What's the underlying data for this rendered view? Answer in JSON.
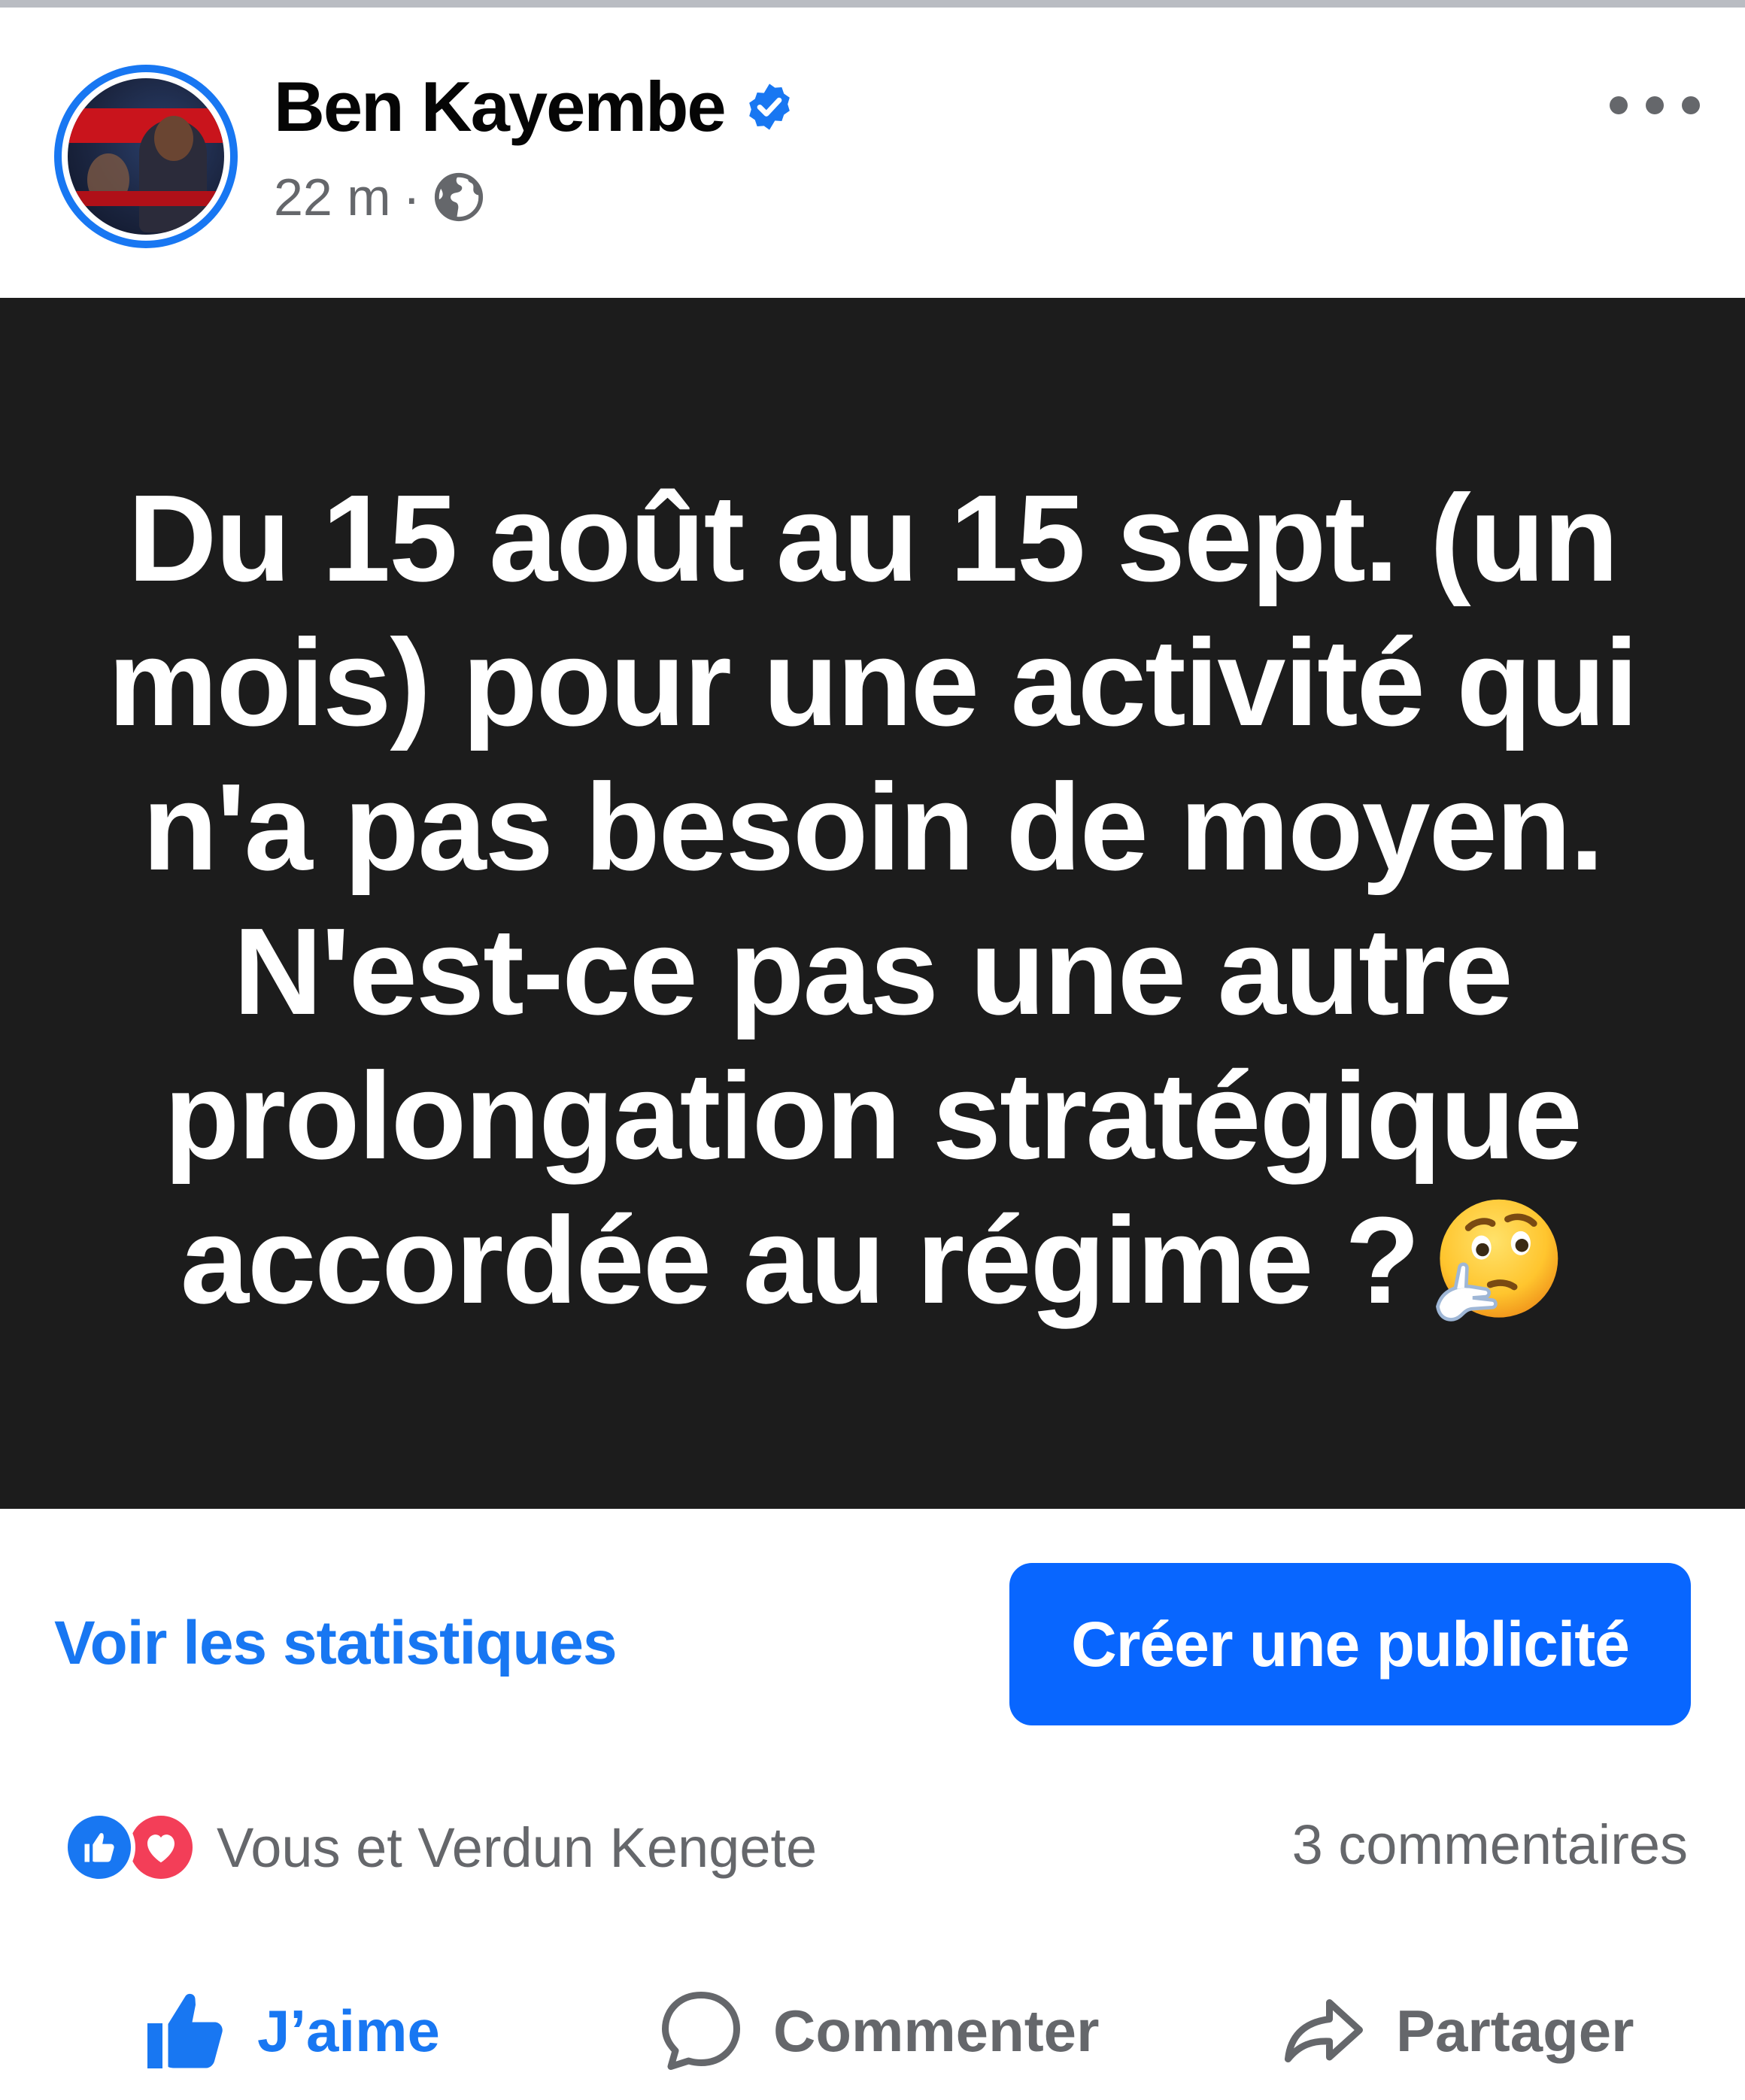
{
  "post": {
    "author": "Ben Kayembe",
    "time": "22 m",
    "separator": "·",
    "visibility_icon": "globe-icon",
    "verified_icon": "verified-badge-icon",
    "more_icon": "more-options-icon",
    "text_lines": [
      "Du 15 août au 15 sept. (un",
      "mois) pour une activité qui",
      "n'a pas besoin de moyen.",
      "N'est-ce pas une autre",
      "prolongation stratégique",
      "accordée au régime ?"
    ],
    "emoji": "thinking-face-emoji"
  },
  "insights": {
    "stats_link": "Voir les statistiques",
    "ad_button": "Créer une publicité"
  },
  "engagement": {
    "reaction_icons": [
      "like-reaction-icon",
      "love-reaction-icon"
    ],
    "reactors": "Vous et Verdun Kengete",
    "comments": "3 commentaires"
  },
  "actions": {
    "like": "J’aime",
    "comment": "Commenter",
    "share": "Partager"
  },
  "colors": {
    "brand_blue": "#1877f2",
    "button_blue": "#0866ff",
    "post_background": "#1c1c1c",
    "muted_text": "#65676b",
    "love_red": "#f33e58"
  }
}
